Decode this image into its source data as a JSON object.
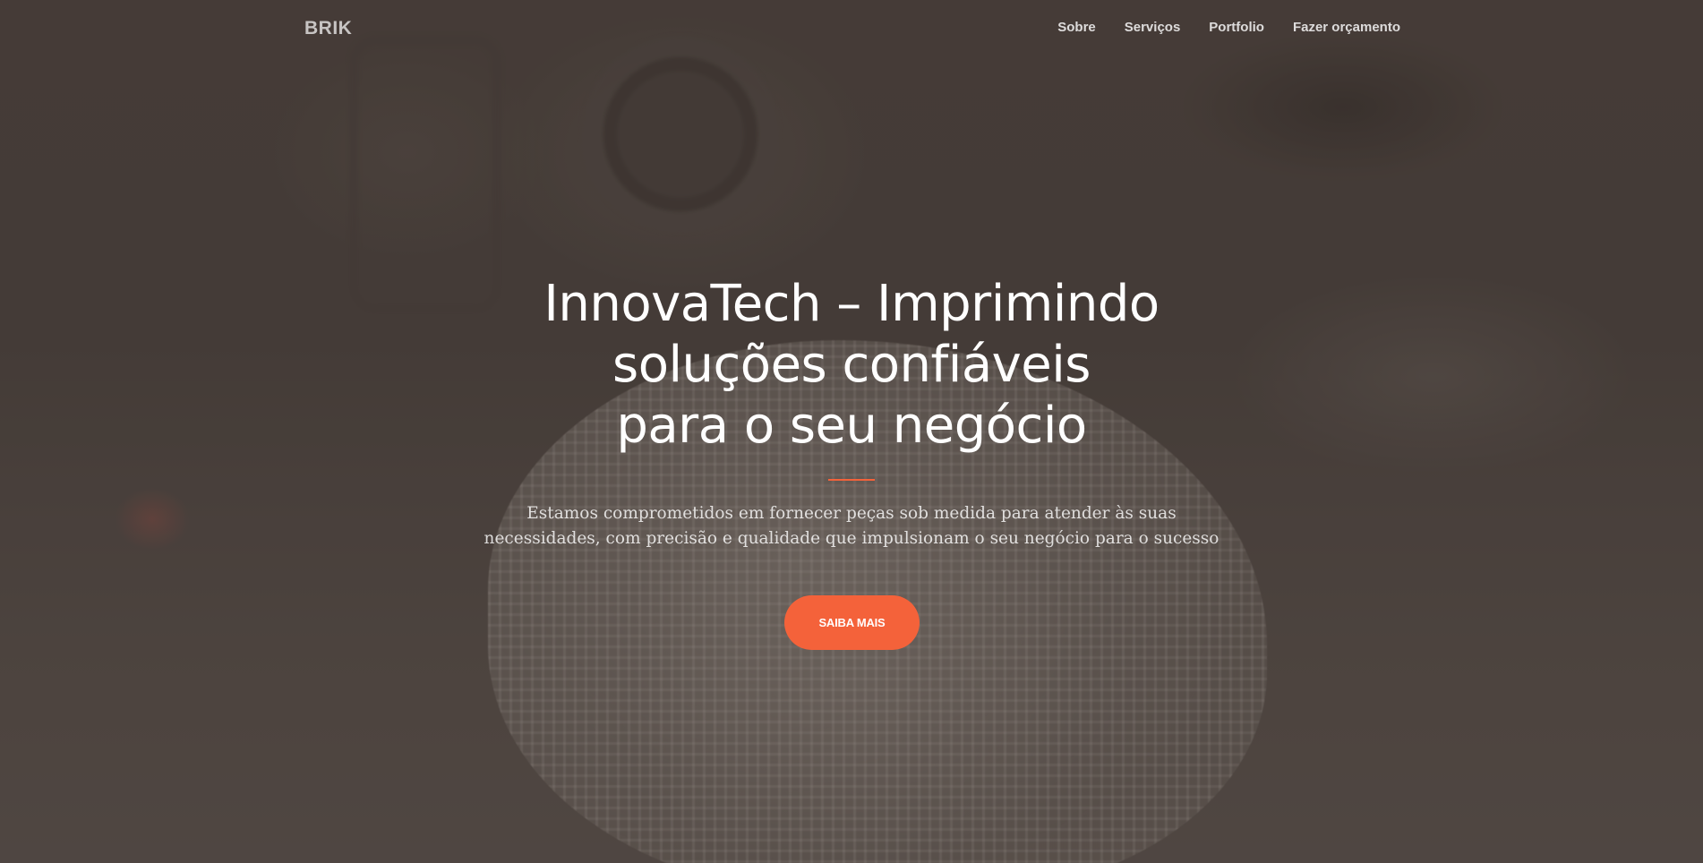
{
  "navbar": {
    "brand": "BRIK",
    "links": [
      {
        "label": "Sobre"
      },
      {
        "label": "Serviços"
      },
      {
        "label": "Portfolio"
      },
      {
        "label": "Fazer orçamento"
      }
    ]
  },
  "hero": {
    "title_line1": "InnovaTech – Imprimindo",
    "title_line2": "soluções confiáveis",
    "title_line3": "para o seu negócio",
    "subtitle_line1": "Estamos comprometidos em fornecer peças sob medida para atender às suas",
    "subtitle_line2": "necessidades, com precisão e qualidade que impulsionam o seu negócio para o sucesso",
    "cta_label": "SAIBA MAIS"
  },
  "colors": {
    "accent": "#f4623a",
    "overlay": "#3e342e"
  }
}
